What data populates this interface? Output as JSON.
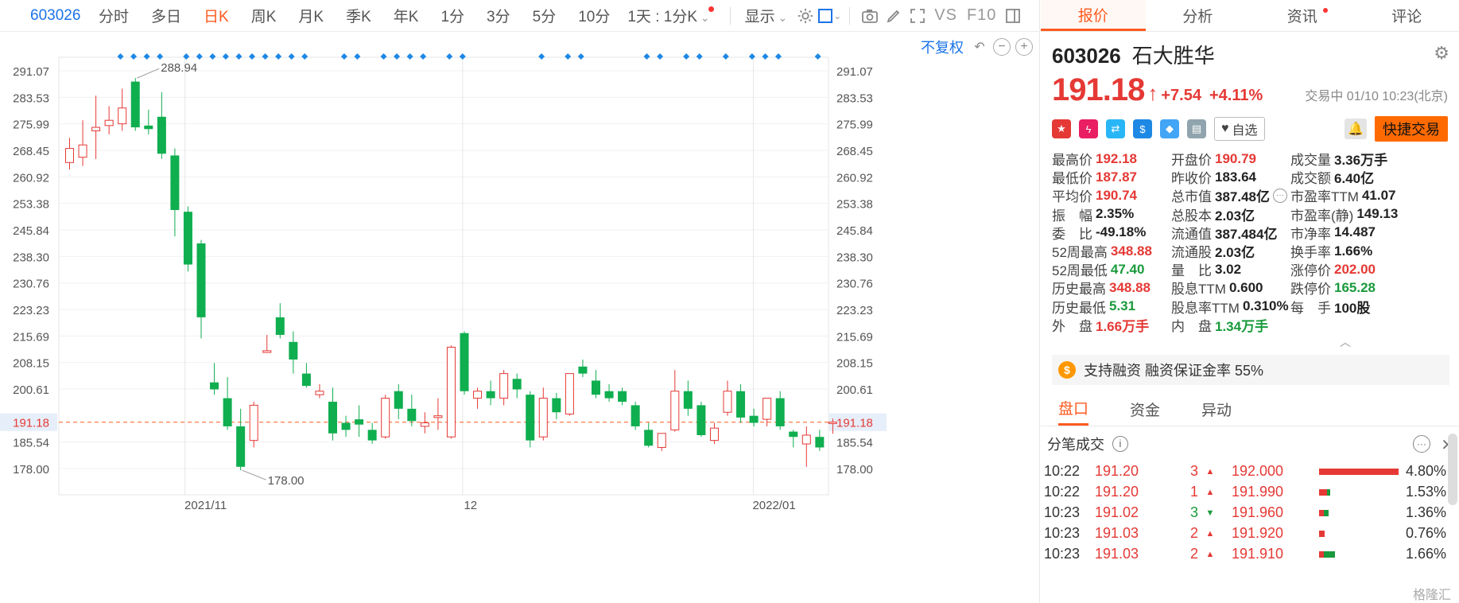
{
  "toolbar": {
    "code": "603026",
    "tabs": [
      "分时",
      "多日",
      "日K",
      "周K",
      "月K",
      "季K",
      "年K",
      "1分",
      "3分",
      "5分",
      "10分"
    ],
    "active_tab": "日K",
    "period_dropdown": "1天 : 1分K",
    "display_dropdown": "显示",
    "vs_label": "VS",
    "f10_label": "F10"
  },
  "chart": {
    "fuquan_label": "不复权",
    "y_ticks": [
      "291.07",
      "283.53",
      "275.99",
      "268.45",
      "260.92",
      "253.38",
      "245.84",
      "238.30",
      "230.76",
      "223.23",
      "215.69",
      "208.15",
      "200.61",
      "185.54",
      "178.00"
    ],
    "x_ticks": [
      "2021/11",
      "12",
      "2022/01"
    ],
    "current_price_label": "191.18",
    "max_annotation": "288.94",
    "min_annotation": "178.00",
    "up_color": "#e53935",
    "down_color": "#0fae4f",
    "accent_color": "#ff5a1f"
  },
  "chart_data": {
    "type": "candlestick",
    "ylim": [
      178.0,
      291.07
    ],
    "candles": [
      {
        "o": 265.0,
        "h": 272.0,
        "l": 263.0,
        "c": 269.0
      },
      {
        "o": 266.5,
        "h": 277.0,
        "l": 264.0,
        "c": 270.0
      },
      {
        "o": 274.0,
        "h": 284.0,
        "l": 266.0,
        "c": 275.0
      },
      {
        "o": 275.5,
        "h": 281.0,
        "l": 273.0,
        "c": 277.0
      },
      {
        "o": 276.0,
        "h": 286.0,
        "l": 274.0,
        "c": 280.5
      },
      {
        "o": 288.0,
        "h": 289.0,
        "l": 274.0,
        "c": 275.0
      },
      {
        "o": 275.5,
        "h": 280.0,
        "l": 273.0,
        "c": 274.5
      },
      {
        "o": 278.0,
        "h": 285.0,
        "l": 266.0,
        "c": 267.5
      },
      {
        "o": 267.0,
        "h": 269.0,
        "l": 244.0,
        "c": 251.5
      },
      {
        "o": 251.0,
        "h": 252.5,
        "l": 234.0,
        "c": 236.0
      },
      {
        "o": 242.0,
        "h": 243.0,
        "l": 215.0,
        "c": 221.0
      },
      {
        "o": 202.5,
        "h": 208.0,
        "l": 199.0,
        "c": 200.5
      },
      {
        "o": 198.0,
        "h": 204.0,
        "l": 189.0,
        "c": 190.0
      },
      {
        "o": 190.0,
        "h": 195.0,
        "l": 177.5,
        "c": 178.5
      },
      {
        "o": 186.0,
        "h": 197.0,
        "l": 184.0,
        "c": 196.0
      },
      {
        "o": 211.0,
        "h": 216.0,
        "l": 211.0,
        "c": 211.5
      },
      {
        "o": 221.0,
        "h": 225.0,
        "l": 215.0,
        "c": 216.0
      },
      {
        "o": 214.0,
        "h": 217.0,
        "l": 205.0,
        "c": 209.0
      },
      {
        "o": 205.0,
        "h": 208.0,
        "l": 201.0,
        "c": 201.5
      },
      {
        "o": 199.0,
        "h": 202.0,
        "l": 198.0,
        "c": 200.0
      },
      {
        "o": 197.0,
        "h": 201.0,
        "l": 186.0,
        "c": 188.0
      },
      {
        "o": 191.0,
        "h": 193.0,
        "l": 187.0,
        "c": 189.0
      },
      {
        "o": 192.0,
        "h": 196.0,
        "l": 187.0,
        "c": 190.5
      },
      {
        "o": 189.0,
        "h": 191.0,
        "l": 185.0,
        "c": 186.0
      },
      {
        "o": 187.0,
        "h": 199.0,
        "l": 186.5,
        "c": 198.0
      },
      {
        "o": 200.0,
        "h": 202.0,
        "l": 192.0,
        "c": 195.0
      },
      {
        "o": 195.0,
        "h": 199.0,
        "l": 190.0,
        "c": 191.5
      },
      {
        "o": 190.0,
        "h": 194.0,
        "l": 188.0,
        "c": 191.0
      },
      {
        "o": 192.5,
        "h": 198.0,
        "l": 189.0,
        "c": 193.0
      },
      {
        "o": 187.0,
        "h": 213.0,
        "l": 186.5,
        "c": 212.5
      },
      {
        "o": 216.5,
        "h": 217.0,
        "l": 199.0,
        "c": 200.0
      },
      {
        "o": 198.0,
        "h": 201.0,
        "l": 195.0,
        "c": 200.0
      },
      {
        "o": 200.0,
        "h": 203.0,
        "l": 196.0,
        "c": 198.0
      },
      {
        "o": 198.0,
        "h": 206.0,
        "l": 196.0,
        "c": 205.0
      },
      {
        "o": 203.5,
        "h": 205.0,
        "l": 198.0,
        "c": 200.5
      },
      {
        "o": 199.0,
        "h": 200.0,
        "l": 184.0,
        "c": 186.0
      },
      {
        "o": 187.0,
        "h": 201.0,
        "l": 186.0,
        "c": 198.0
      },
      {
        "o": 198.0,
        "h": 199.5,
        "l": 192.0,
        "c": 194.0
      },
      {
        "o": 193.5,
        "h": 205.0,
        "l": 193.0,
        "c": 205.0
      },
      {
        "o": 207.0,
        "h": 209.0,
        "l": 204.0,
        "c": 205.0
      },
      {
        "o": 203.0,
        "h": 206.0,
        "l": 198.0,
        "c": 199.0
      },
      {
        "o": 200.0,
        "h": 202.0,
        "l": 197.0,
        "c": 198.0
      },
      {
        "o": 200.0,
        "h": 201.0,
        "l": 196.0,
        "c": 197.0
      },
      {
        "o": 196.0,
        "h": 197.0,
        "l": 189.0,
        "c": 190.0
      },
      {
        "o": 189.0,
        "h": 191.0,
        "l": 184.0,
        "c": 184.5
      },
      {
        "o": 184.0,
        "h": 188.0,
        "l": 183.0,
        "c": 188.0
      },
      {
        "o": 189.0,
        "h": 206.0,
        "l": 188.5,
        "c": 200.0
      },
      {
        "o": 200.0,
        "h": 203.0,
        "l": 193.0,
        "c": 195.0
      },
      {
        "o": 196.0,
        "h": 197.0,
        "l": 187.0,
        "c": 187.5
      },
      {
        "o": 186.0,
        "h": 191.0,
        "l": 185.0,
        "c": 189.5
      },
      {
        "o": 194.0,
        "h": 203.0,
        "l": 193.0,
        "c": 200.0
      },
      {
        "o": 200.0,
        "h": 202.0,
        "l": 191.0,
        "c": 192.5
      },
      {
        "o": 193.0,
        "h": 195.0,
        "l": 190.0,
        "c": 191.0
      },
      {
        "o": 192.0,
        "h": 198.0,
        "l": 190.0,
        "c": 198.0
      },
      {
        "o": 198.0,
        "h": 200.0,
        "l": 189.0,
        "c": 190.0
      },
      {
        "o": 188.5,
        "h": 189.0,
        "l": 184.0,
        "c": 187.0
      },
      {
        "o": 185.0,
        "h": 190.0,
        "l": 178.5,
        "c": 187.5
      },
      {
        "o": 187.0,
        "h": 189.0,
        "l": 183.0,
        "c": 184.0
      },
      {
        "o": 190.8,
        "h": 192.2,
        "l": 187.9,
        "c": 191.2
      }
    ]
  },
  "stock": {
    "code": "603026",
    "name": "石大胜华",
    "price": "191.18",
    "change": "+7.54",
    "change_pct": "+4.11%",
    "status": "交易中 01/10 10:23(北京)",
    "zixuan": "自选",
    "fast_trade": "快捷交易"
  },
  "right_tabs": [
    "报价",
    "分析",
    "资讯",
    "评论"
  ],
  "quote": [
    {
      "label": "最高价",
      "value": "192.18",
      "color": "red"
    },
    {
      "label": "开盘价",
      "value": "190.79",
      "color": "red"
    },
    {
      "label": "成交量",
      "value": "3.36万手",
      "color": ""
    },
    {
      "label": "最低价",
      "value": "187.87",
      "color": "red"
    },
    {
      "label": "昨收价",
      "value": "183.64",
      "color": ""
    },
    {
      "label": "成交额",
      "value": "6.40亿",
      "color": ""
    },
    {
      "label": "平均价",
      "value": "190.74",
      "color": "red"
    },
    {
      "label": "总市值",
      "value": "387.48亿",
      "color": ""
    },
    {
      "label": "市盈率TTM",
      "value": "41.07",
      "color": ""
    },
    {
      "label": "振　幅",
      "value": "2.35%",
      "color": ""
    },
    {
      "label": "总股本",
      "value": "2.03亿",
      "color": ""
    },
    {
      "label": "市盈率(静)",
      "value": "149.13",
      "color": ""
    },
    {
      "label": "委　比",
      "value": "-49.18%",
      "color": ""
    },
    {
      "label": "流通值",
      "value": "387.484亿",
      "color": ""
    },
    {
      "label": "市净率",
      "value": "14.487",
      "color": ""
    },
    {
      "label": "52周最高",
      "value": "348.88",
      "color": "red"
    },
    {
      "label": "流通股",
      "value": "2.03亿",
      "color": ""
    },
    {
      "label": "换手率",
      "value": "1.66%",
      "color": ""
    },
    {
      "label": "52周最低",
      "value": "47.40",
      "color": "green"
    },
    {
      "label": "量　比",
      "value": "3.02",
      "color": ""
    },
    {
      "label": "涨停价",
      "value": "202.00",
      "color": "red"
    },
    {
      "label": "历史最高",
      "value": "348.88",
      "color": "red"
    },
    {
      "label": "股息TTM",
      "value": "0.600",
      "color": ""
    },
    {
      "label": "跌停价",
      "value": "165.28",
      "color": "green"
    },
    {
      "label": "历史最低",
      "value": "5.31",
      "color": "green"
    },
    {
      "label": "股息率TTM",
      "value": "0.310%",
      "color": ""
    },
    {
      "label": "每　手",
      "value": "100股",
      "color": ""
    },
    {
      "label": "外　盘",
      "value": "1.66万手",
      "color": "red"
    },
    {
      "label": "内　盘",
      "value": "1.34万手",
      "color": "green"
    }
  ],
  "margin": {
    "text": "支持融资 融资保证金率 55%"
  },
  "sub_tabs": [
    "盘口",
    "资金",
    "异动"
  ],
  "trades": {
    "title": "分笔成交",
    "rows": [
      {
        "time": "10:22",
        "price": "191.20",
        "vol": "3",
        "dir": "up",
        "ask": "192.000",
        "red": 1.0,
        "green": 0.0,
        "pct": "4.80%"
      },
      {
        "time": "10:22",
        "price": "191.20",
        "vol": "1",
        "dir": "up",
        "ask": "191.990",
        "red": 0.1,
        "green": 0.04,
        "pct": "1.53%"
      },
      {
        "time": "10:23",
        "price": "191.02",
        "vol": "3",
        "dir": "down",
        "ask": "191.960",
        "red": 0.06,
        "green": 0.06,
        "pct": "1.36%"
      },
      {
        "time": "10:23",
        "price": "191.03",
        "vol": "2",
        "dir": "up",
        "ask": "191.920",
        "red": 0.07,
        "green": 0.0,
        "pct": "0.76%"
      },
      {
        "time": "10:23",
        "price": "191.03",
        "vol": "2",
        "dir": "up",
        "ask": "191.910",
        "red": 0.06,
        "green": 0.14,
        "pct": "1.66%"
      }
    ]
  },
  "watermark": "格隆汇"
}
